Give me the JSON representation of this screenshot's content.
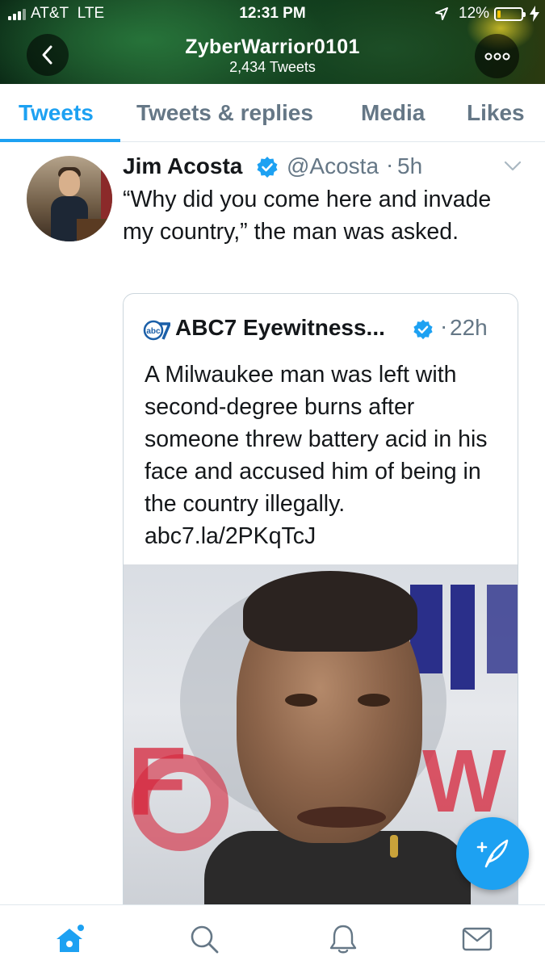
{
  "status_bar": {
    "carrier": "AT&T",
    "network": "LTE",
    "time": "12:31 PM",
    "battery_percent": "12%",
    "battery_level": 0.12
  },
  "header": {
    "profile_name": "ZyberWarrior0101",
    "tweet_count": "2,434 Tweets"
  },
  "tabs": [
    {
      "label": "Tweets",
      "active": true
    },
    {
      "label": "Tweets & replies",
      "active": false
    },
    {
      "label": "Media",
      "active": false
    },
    {
      "label": "Likes",
      "active": false
    }
  ],
  "tweet": {
    "author_name": "Jim Acosta",
    "author_handle": "@Acosta",
    "separator": "·",
    "time": "5h",
    "text": "“Why did you come here and invade my country,” the man was asked.",
    "quoted": {
      "author_name": "ABC7 Eyewitness...",
      "separator": "·",
      "time": "22h",
      "text": "A Milwaukee man was left with second-degree burns after someone threw battery acid in his face and accused him of being in the country illegally.",
      "link": "abc7.la/2PKqTcJ"
    }
  },
  "icons": {
    "back": "chevron-left-icon",
    "more": "more-icon",
    "verified": "verified-badge-icon",
    "caret": "chevron-down-icon",
    "compose": "compose-tweet-icon",
    "home": "home-icon",
    "search": "search-icon",
    "notifications": "bell-icon",
    "messages": "mail-icon"
  },
  "colors": {
    "accent": "#1da1f2",
    "text_primary": "#14171a",
    "text_secondary": "#657786"
  }
}
